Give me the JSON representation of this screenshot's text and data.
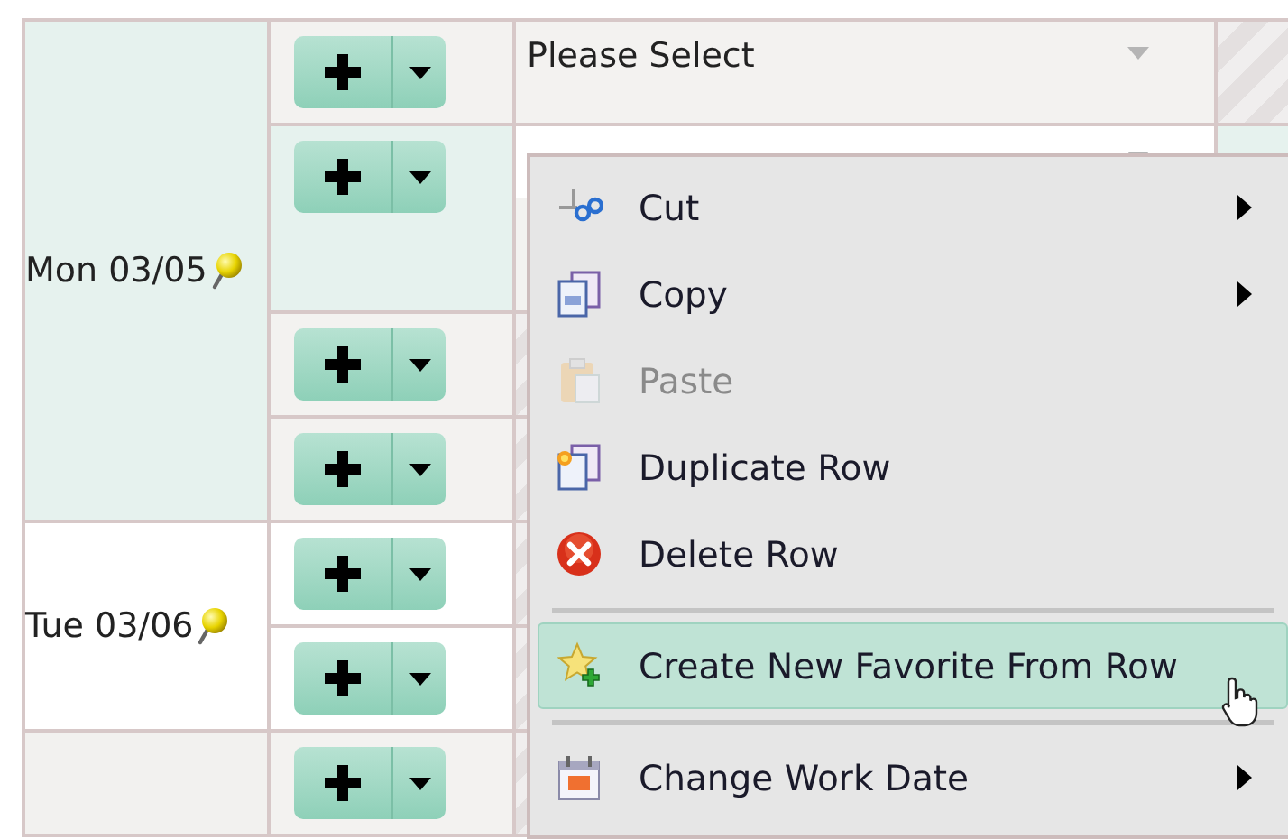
{
  "days": [
    {
      "label": "Mon 03/05",
      "note": true,
      "rows": [
        {
          "selected": false,
          "field": {
            "value": "Please Select"
          }
        },
        {
          "selected": true,
          "field": {}
        },
        {
          "selected": false
        },
        {
          "selected": false
        }
      ]
    },
    {
      "label": "Tue 03/06",
      "note": true,
      "rows": [
        {
          "selected": false
        },
        {
          "selected": false
        }
      ]
    },
    {
      "note": false,
      "rows": [
        {
          "selected": false
        }
      ]
    }
  ],
  "context_menu": {
    "items": [
      {
        "kind": "item",
        "label": "Cut",
        "disabled": false,
        "submenu": true,
        "selected": false
      },
      {
        "kind": "item",
        "label": "Copy",
        "disabled": false,
        "submenu": true,
        "selected": false
      },
      {
        "kind": "item",
        "label": "Paste",
        "disabled": true,
        "submenu": false,
        "selected": false
      },
      {
        "kind": "item",
        "label": "Duplicate Row",
        "disabled": false,
        "submenu": false,
        "selected": false
      },
      {
        "kind": "item",
        "label": "Delete Row",
        "disabled": false,
        "submenu": false,
        "selected": false
      },
      {
        "kind": "separator"
      },
      {
        "kind": "item",
        "label": "Create New Favorite From Row",
        "disabled": false,
        "submenu": false,
        "selected": true
      },
      {
        "kind": "separator"
      },
      {
        "kind": "item",
        "label": "Change Work Date",
        "disabled": false,
        "submenu": true,
        "selected": false
      }
    ]
  }
}
